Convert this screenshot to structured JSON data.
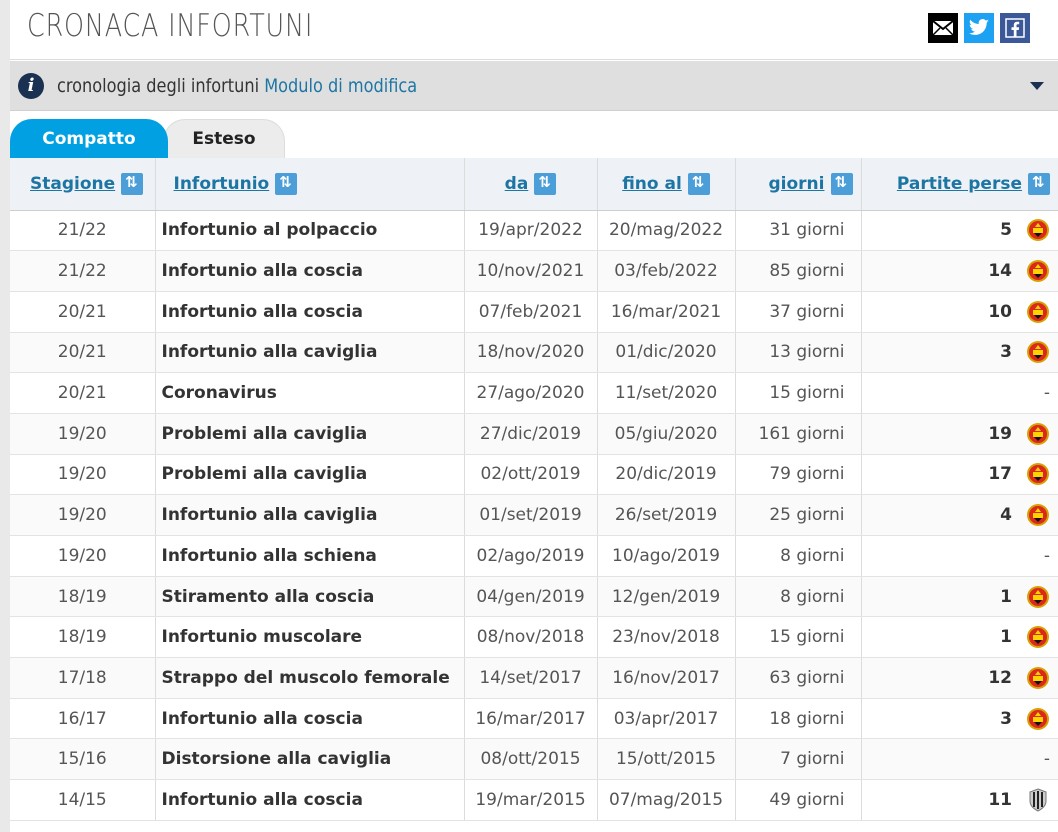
{
  "header": {
    "title": "CRONACA INFORTUNI"
  },
  "infobar": {
    "text": "cronologia degli infortuni",
    "link": "Modulo di modifica"
  },
  "tabs": [
    {
      "label": "Compatto",
      "active": true
    },
    {
      "label": "Esteso",
      "active": false
    }
  ],
  "table": {
    "columns": [
      "Stagione",
      "Infortunio",
      "da",
      "fino al",
      "giorni",
      "Partite perse"
    ],
    "rows": [
      {
        "season": "21/22",
        "injury": "Infortunio al polpaccio",
        "from": "19/apr/2022",
        "to": "20/mag/2022",
        "days": "31 giorni",
        "games": "5",
        "club": "manchester-united-crest"
      },
      {
        "season": "21/22",
        "injury": "Infortunio alla coscia",
        "from": "10/nov/2021",
        "to": "03/feb/2022",
        "days": "85 giorni",
        "games": "14",
        "club": "manchester-united-crest"
      },
      {
        "season": "20/21",
        "injury": "Infortunio alla coscia",
        "from": "07/feb/2021",
        "to": "16/mar/2021",
        "days": "37 giorni",
        "games": "10",
        "club": "manchester-united-crest"
      },
      {
        "season": "20/21",
        "injury": "Infortunio alla caviglia",
        "from": "18/nov/2020",
        "to": "01/dic/2020",
        "days": "13 giorni",
        "games": "3",
        "club": "manchester-united-crest"
      },
      {
        "season": "20/21",
        "injury": "Coronavirus",
        "from": "27/ago/2020",
        "to": "11/set/2020",
        "days": "15 giorni",
        "games": "-",
        "club": ""
      },
      {
        "season": "19/20",
        "injury": "Problemi alla caviglia",
        "from": "27/dic/2019",
        "to": "05/giu/2020",
        "days": "161 giorni",
        "games": "19",
        "club": "manchester-united-crest"
      },
      {
        "season": "19/20",
        "injury": "Problemi alla caviglia",
        "from": "02/ott/2019",
        "to": "20/dic/2019",
        "days": "79 giorni",
        "games": "17",
        "club": "manchester-united-crest"
      },
      {
        "season": "19/20",
        "injury": "Infortunio alla caviglia",
        "from": "01/set/2019",
        "to": "26/set/2019",
        "days": "25 giorni",
        "games": "4",
        "club": "manchester-united-crest"
      },
      {
        "season": "19/20",
        "injury": "Infortunio alla schiena",
        "from": "02/ago/2019",
        "to": "10/ago/2019",
        "days": "8 giorni",
        "games": "-",
        "club": ""
      },
      {
        "season": "18/19",
        "injury": "Stiramento alla coscia",
        "from": "04/gen/2019",
        "to": "12/gen/2019",
        "days": "8 giorni",
        "games": "1",
        "club": "manchester-united-crest"
      },
      {
        "season": "18/19",
        "injury": "Infortunio muscolare",
        "from": "08/nov/2018",
        "to": "23/nov/2018",
        "days": "15 giorni",
        "games": "1",
        "club": "manchester-united-crest"
      },
      {
        "season": "17/18",
        "injury": "Strappo del muscolo femorale",
        "from": "14/set/2017",
        "to": "16/nov/2017",
        "days": "63 giorni",
        "games": "12",
        "club": "manchester-united-crest"
      },
      {
        "season": "16/17",
        "injury": "Infortunio alla coscia",
        "from": "16/mar/2017",
        "to": "03/apr/2017",
        "days": "18 giorni",
        "games": "3",
        "club": "manchester-united-crest"
      },
      {
        "season": "15/16",
        "injury": "Distorsione alla caviglia",
        "from": "08/ott/2015",
        "to": "15/ott/2015",
        "days": "7 giorni",
        "games": "-",
        "club": ""
      },
      {
        "season": "14/15",
        "injury": "Infortunio alla coscia",
        "from": "19/mar/2015",
        "to": "07/mag/2015",
        "days": "49 giorni",
        "games": "11",
        "club": "juventus-crest"
      }
    ]
  },
  "colors": {
    "accent": "#00a0e3",
    "link": "#1d75a3",
    "sort_icon": "#4b9ed8",
    "info_icon": "#1a3151",
    "twitter": "#1da1f2",
    "facebook": "#3b5998"
  }
}
